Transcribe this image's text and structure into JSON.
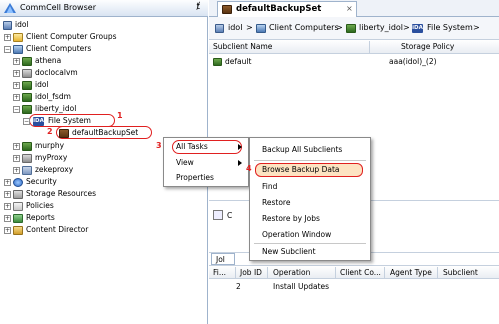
{
  "left_pane": {
    "title": "CommCell Browser",
    "pin_glyph": "ⱦ",
    "tree": [
      {
        "label": "idol",
        "icon": "commcell-icon"
      },
      {
        "label": "Client Computer Groups",
        "icon": "group-icon"
      },
      {
        "label": "Client Computers",
        "icon": "clients-icon"
      },
      {
        "label": "athena",
        "icon": "server-icon"
      },
      {
        "label": "doclocalvm",
        "icon": "proxy-icon"
      },
      {
        "label": "idol",
        "icon": "server-icon"
      },
      {
        "label": "idol_fsdm",
        "icon": "server-icon"
      },
      {
        "label": "liberty_idol",
        "icon": "server-icon"
      },
      {
        "label": "File System",
        "icon": "filesystem-icon"
      },
      {
        "label": "defaultBackupSet",
        "icon": "backupset-icon"
      },
      {
        "label": "murphy",
        "icon": "server-icon"
      },
      {
        "label": "myProxy",
        "icon": "proxy-icon"
      },
      {
        "label": "zekeproxy",
        "icon": "zek-icon"
      },
      {
        "label": "Security",
        "icon": "security-icon"
      },
      {
        "label": "Storage Resources",
        "icon": "storage-icon"
      },
      {
        "label": "Policies",
        "icon": "policies-icon"
      },
      {
        "label": "Reports",
        "icon": "reports-icon"
      },
      {
        "label": "Content Director",
        "icon": "content-director-icon"
      }
    ],
    "step_labels": {
      "one": "1",
      "two": "2",
      "three": "3",
      "four": "4"
    }
  },
  "tab": {
    "title": "defaultBackupSet",
    "close_glyph": "×"
  },
  "breadcrumb": {
    "items": [
      "idol",
      "Client Computers",
      "liberty_idol",
      "File System"
    ],
    "separator": ">"
  },
  "subclient_table": {
    "headers": [
      "Subclient Name",
      "Storage Policy"
    ],
    "rows": [
      {
        "name": "default",
        "policy": "aaa(idol)_(2)"
      }
    ]
  },
  "context_menu": {
    "items": [
      {
        "label": "All Tasks",
        "has_submenu": true
      },
      {
        "label": "View",
        "has_submenu": true
      },
      {
        "label": "Properties",
        "has_submenu": false
      }
    ]
  },
  "submenu": {
    "items": [
      "Backup All Subclients",
      "Browse Backup Data",
      "Find",
      "Restore",
      "Restore by Jobs",
      "Operation Window",
      "New Subclient"
    ]
  },
  "mid_pane": {
    "label": "C"
  },
  "job_pane": {
    "tab_label": "Jol",
    "headers": [
      "Fi...",
      "Job ID",
      "Operation",
      "Client Co...",
      "Agent Type",
      "Subclient"
    ],
    "rows": [
      {
        "job_id": "2",
        "operation": "Install Updates"
      }
    ]
  },
  "colors": {
    "highlight_red": "#e02020",
    "selection_orange": "#f4a14a"
  }
}
